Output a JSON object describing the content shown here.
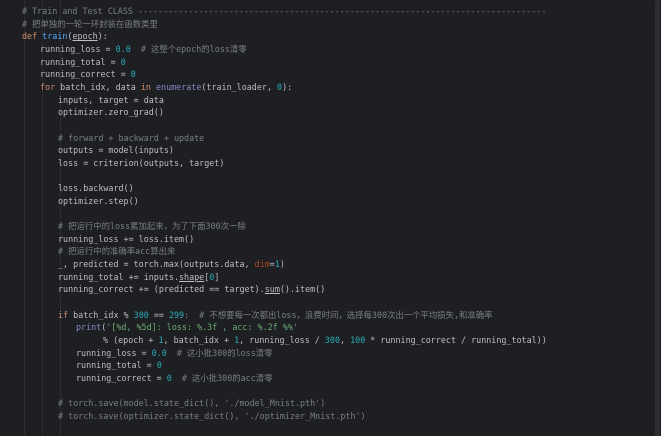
{
  "editor": {
    "lines": [
      {
        "indent": 0,
        "tokens": [
          {
            "t": "# Train and Test CLASS ---------------------------------------------------------------------------------",
            "c": "comment"
          }
        ]
      },
      {
        "indent": 0,
        "tokens": [
          {
            "t": "# 把单独的一轮一环封装在函数类里",
            "c": "comment"
          }
        ]
      },
      {
        "indent": 0,
        "tokens": [
          {
            "t": "def ",
            "c": "kw"
          },
          {
            "t": "train",
            "c": "fn"
          },
          {
            "t": "("
          },
          {
            "t": "epoch",
            "c": "u"
          },
          {
            "t": "):"
          }
        ]
      },
      {
        "indent": 4,
        "tokens": [
          {
            "t": "running_loss = "
          },
          {
            "t": "0.0",
            "c": "num"
          },
          {
            "t": "  # 这整个epoch的loss清零",
            "c": "comment"
          }
        ]
      },
      {
        "indent": 4,
        "tokens": [
          {
            "t": "running_total = "
          },
          {
            "t": "0",
            "c": "num"
          }
        ]
      },
      {
        "indent": 4,
        "tokens": [
          {
            "t": "running_correct = "
          },
          {
            "t": "0",
            "c": "num"
          }
        ]
      },
      {
        "indent": 4,
        "tokens": [
          {
            "t": "for ",
            "c": "kw"
          },
          {
            "t": "batch_idx, data "
          },
          {
            "t": "in ",
            "c": "kw"
          },
          {
            "t": "enumerate",
            "c": "builtin"
          },
          {
            "t": "(train_loader, "
          },
          {
            "t": "0",
            "c": "num"
          },
          {
            "t": "):"
          }
        ]
      },
      {
        "indent": 8,
        "tokens": [
          {
            "t": "inputs, target = data"
          }
        ]
      },
      {
        "indent": 8,
        "tokens": [
          {
            "t": "optimizer.zero_grad()"
          }
        ]
      },
      {
        "indent": 0,
        "tokens": []
      },
      {
        "indent": 8,
        "tokens": [
          {
            "t": "# forward + backward + update",
            "c": "comment"
          }
        ]
      },
      {
        "indent": 8,
        "tokens": [
          {
            "t": "outputs = model(inputs)"
          }
        ]
      },
      {
        "indent": 8,
        "tokens": [
          {
            "t": "loss = criterion(outputs, target)"
          }
        ]
      },
      {
        "indent": 0,
        "tokens": []
      },
      {
        "indent": 8,
        "tokens": [
          {
            "t": "loss.backward()"
          }
        ]
      },
      {
        "indent": 8,
        "tokens": [
          {
            "t": "optimizer.step()"
          }
        ]
      },
      {
        "indent": 0,
        "tokens": []
      },
      {
        "indent": 8,
        "tokens": [
          {
            "t": "# 把运行中的loss累加起来，为了下面300次一除",
            "c": "comment"
          }
        ]
      },
      {
        "indent": 8,
        "tokens": [
          {
            "t": "running_loss += loss.item()"
          }
        ]
      },
      {
        "indent": 8,
        "tokens": [
          {
            "t": "# 把运行中的准确率acc算出来",
            "c": "comment"
          }
        ]
      },
      {
        "indent": 8,
        "tokens": [
          {
            "t": "_, predicted = torch.max(outputs.data, "
          },
          {
            "t": "dim",
            "c": "param"
          },
          {
            "t": "="
          },
          {
            "t": "1",
            "c": "num"
          },
          {
            "t": ")"
          }
        ]
      },
      {
        "indent": 8,
        "tokens": [
          {
            "t": "running_total += inputs."
          },
          {
            "t": "shape",
            "c": "u"
          },
          {
            "t": "["
          },
          {
            "t": "0",
            "c": "num"
          },
          {
            "t": "]"
          }
        ]
      },
      {
        "indent": 8,
        "tokens": [
          {
            "t": "running_correct += (predicted == target)."
          },
          {
            "t": "sum",
            "c": "u"
          },
          {
            "t": "().item()"
          }
        ]
      },
      {
        "indent": 0,
        "tokens": []
      },
      {
        "indent": 8,
        "tokens": [
          {
            "t": "if ",
            "c": "kw"
          },
          {
            "t": "batch_idx % "
          },
          {
            "t": "300",
            "c": "num"
          },
          {
            "t": " == "
          },
          {
            "t": "299",
            "c": "num"
          },
          {
            "t": ":  # 不想要每一次都出loss，浪费时间，选择每300次出一个平均损失,和准确率",
            "c": "comment"
          }
        ]
      },
      {
        "indent": 12,
        "tokens": [
          {
            "t": "print",
            "c": "builtin"
          },
          {
            "t": "("
          },
          {
            "t": "'[%d, %5d]: loss: %.3f , acc: %.2f %%'",
            "c": "str"
          }
        ]
      },
      {
        "indent": 18,
        "tokens": [
          {
            "t": "% (epoch + "
          },
          {
            "t": "1",
            "c": "num"
          },
          {
            "t": ", batch_idx + "
          },
          {
            "t": "1",
            "c": "num"
          },
          {
            "t": ", running_loss / "
          },
          {
            "t": "300",
            "c": "num"
          },
          {
            "t": ", "
          },
          {
            "t": "100",
            "c": "num"
          },
          {
            "t": " * running_correct / running_total))"
          }
        ]
      },
      {
        "indent": 12,
        "tokens": [
          {
            "t": "running_loss = "
          },
          {
            "t": "0.0",
            "c": "num"
          },
          {
            "t": "  # 这小批300的loss清零",
            "c": "comment"
          }
        ]
      },
      {
        "indent": 12,
        "tokens": [
          {
            "t": "running_total = "
          },
          {
            "t": "0",
            "c": "num"
          }
        ]
      },
      {
        "indent": 12,
        "tokens": [
          {
            "t": "running_correct = "
          },
          {
            "t": "0",
            "c": "num"
          },
          {
            "t": "  # 这小批300的acc清零",
            "c": "comment"
          }
        ]
      },
      {
        "indent": 0,
        "tokens": []
      },
      {
        "indent": 8,
        "tokens": [
          {
            "t": "# torch.save(model.state_dict(), './model_Mnist.pth')",
            "c": "comment"
          }
        ]
      },
      {
        "indent": 8,
        "tokens": [
          {
            "t": "# torch.save(optimizer.state_dict(), './optimizer_Mnist.pth')",
            "c": "comment"
          }
        ]
      }
    ]
  }
}
